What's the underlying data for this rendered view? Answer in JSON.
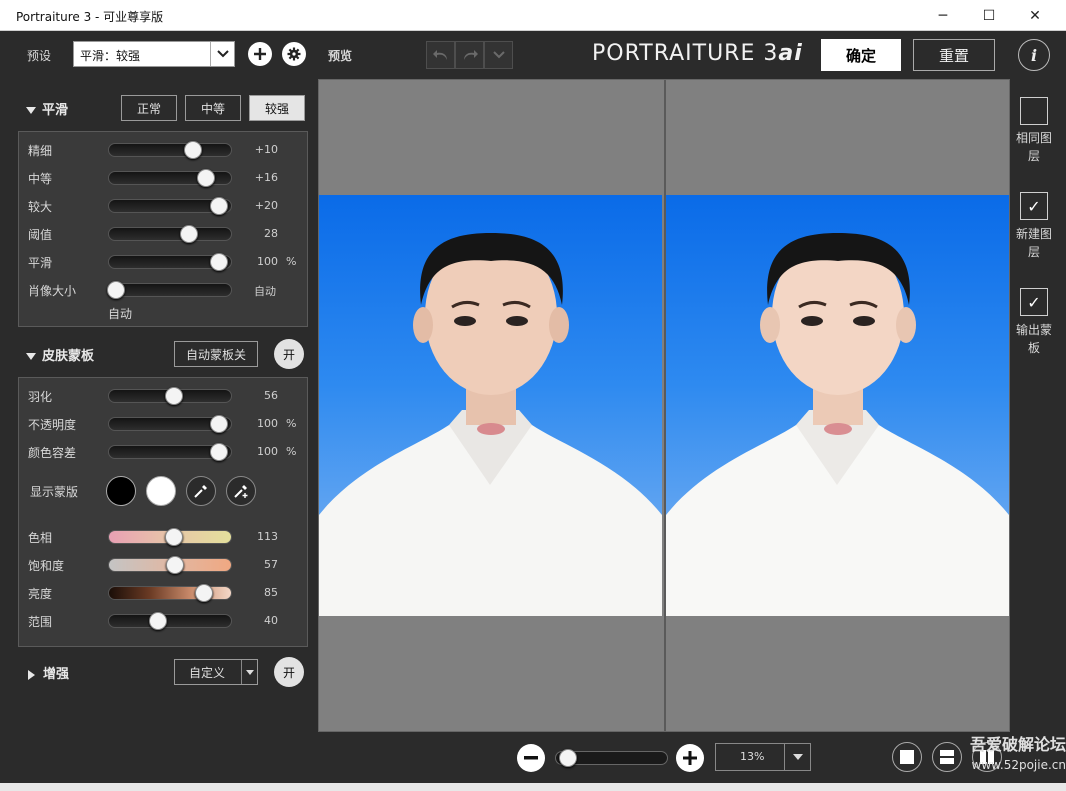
{
  "window": {
    "title": "Portraiture 3 - 可业尊享版",
    "minimize_icon": "─",
    "maximize_icon": "☐",
    "close_icon": "✕"
  },
  "preset": {
    "label": "预设",
    "value": "平滑：较强"
  },
  "preview_label": "预览",
  "logo": {
    "main": "PORTRAITURE 3",
    "suffix": "ai"
  },
  "actions": {
    "ok": "确定",
    "reset": "重置",
    "info": "i"
  },
  "smoothing": {
    "title": "平滑",
    "modes": [
      "正常",
      "中等",
      "较强"
    ],
    "active_mode": "较强",
    "sliders": [
      {
        "label": "精细",
        "value": "+10",
        "unit": "",
        "fraction": 0.73
      },
      {
        "label": "中等",
        "value": "+16",
        "unit": "",
        "fraction": 0.85
      },
      {
        "label": "较大",
        "value": "+20",
        "unit": "",
        "fraction": 0.97
      },
      {
        "label": "阈值",
        "value": "28",
        "unit": "",
        "fraction": 0.69
      },
      {
        "label": "平滑",
        "value": "100",
        "unit": "%",
        "fraction": 0.97
      },
      {
        "label": "肖像大小",
        "value": "自动",
        "unit": "",
        "fraction": 0.0
      }
    ],
    "portrait_size_caption": "自动"
  },
  "skin_mask": {
    "title": "皮肤蒙板",
    "auto_mask_button": "自动蒙板关",
    "toggle": "开",
    "sliders": [
      {
        "label": "羽化",
        "value": "56",
        "unit": "",
        "fraction": 0.55
      },
      {
        "label": "不透明度",
        "value": "100",
        "unit": "%",
        "fraction": 0.97
      },
      {
        "label": "颜色容差",
        "value": "100",
        "unit": "%",
        "fraction": 0.97
      }
    ],
    "show_mask_label": "显示蒙版",
    "tone_sliders": [
      {
        "label": "色相",
        "value": "113",
        "fraction": 0.55
      },
      {
        "label": "饱和度",
        "value": "57",
        "fraction": 0.56
      },
      {
        "label": "亮度",
        "value": "85",
        "fraction": 0.83
      },
      {
        "label": "范围",
        "value": "40",
        "fraction": 0.4
      }
    ]
  },
  "enhance": {
    "title": "增强",
    "preset": "自定义",
    "toggle": "开"
  },
  "output": {
    "same_layer": "相同图层",
    "new_layer": "新建图层",
    "output_mask": "输出蒙板",
    "new_layer_checked": true,
    "output_mask_checked": true,
    "same_layer_checked": false
  },
  "zoom": {
    "value": "13%",
    "level_fraction": 0.05
  },
  "watermark": {
    "line1": "吾爱破解论坛",
    "line2": "www.52pojie.cn"
  },
  "colors": {
    "accent_blue": "#0a6be8",
    "panel": "#3a3a3a",
    "background": "#2b2b2b"
  }
}
